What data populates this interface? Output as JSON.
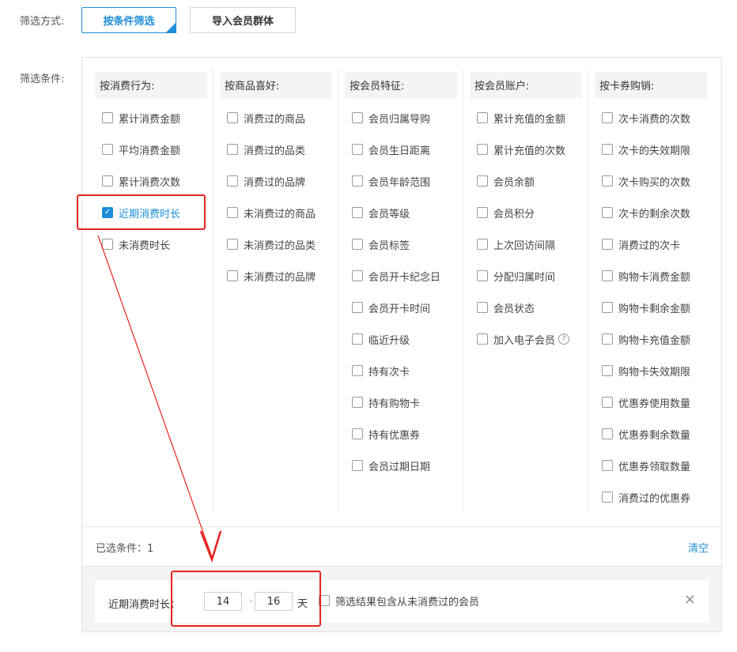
{
  "filter_mode": {
    "label": "筛选方式:",
    "by_condition": "按条件筛选",
    "import_group": "导入会员群体"
  },
  "filter_conditions": {
    "label": "筛选条件:",
    "columns": [
      {
        "header": "按消费行为:",
        "options": [
          {
            "label": "累计消费金额",
            "checked": false
          },
          {
            "label": "平均消费金额",
            "checked": false
          },
          {
            "label": "累计消费次数",
            "checked": false
          },
          {
            "label": "近期消费时长",
            "checked": true
          },
          {
            "label": "未消费时长",
            "checked": false
          }
        ]
      },
      {
        "header": "按商品喜好:",
        "options": [
          {
            "label": "消费过的商品",
            "checked": false
          },
          {
            "label": "消费过的品类",
            "checked": false
          },
          {
            "label": "消费过的品牌",
            "checked": false
          },
          {
            "label": "未消费过的商品",
            "checked": false
          },
          {
            "label": "未消费过的品类",
            "checked": false
          },
          {
            "label": "未消费过的品牌",
            "checked": false
          }
        ]
      },
      {
        "header": "按会员特征:",
        "options": [
          {
            "label": "会员归属导购",
            "checked": false
          },
          {
            "label": "会员生日距离",
            "checked": false
          },
          {
            "label": "会员年龄范围",
            "checked": false
          },
          {
            "label": "会员等级",
            "checked": false
          },
          {
            "label": "会员标签",
            "checked": false
          },
          {
            "label": "会员开卡纪念日",
            "checked": false
          },
          {
            "label": "会员开卡时间",
            "checked": false
          },
          {
            "label": "临近升级",
            "checked": false
          },
          {
            "label": "持有次卡",
            "checked": false
          },
          {
            "label": "持有购物卡",
            "checked": false
          },
          {
            "label": "持有优惠券",
            "checked": false
          },
          {
            "label": "会员过期日期",
            "checked": false
          }
        ]
      },
      {
        "header": "按会员账户:",
        "options": [
          {
            "label": "累计充值的金额",
            "checked": false
          },
          {
            "label": "累计充值的次数",
            "checked": false
          },
          {
            "label": "会员余额",
            "checked": false
          },
          {
            "label": "会员积分",
            "checked": false
          },
          {
            "label": "上次回访间隔",
            "checked": false
          },
          {
            "label": "分配归属时间",
            "checked": false
          },
          {
            "label": "会员状态",
            "checked": false
          },
          {
            "label": "加入电子会员",
            "checked": false,
            "help": "?"
          }
        ]
      },
      {
        "header": "按卡券购销:",
        "options": [
          {
            "label": "次卡消费的次数",
            "checked": false
          },
          {
            "label": "次卡的失效期限",
            "checked": false
          },
          {
            "label": "次卡购买的次数",
            "checked": false
          },
          {
            "label": "次卡的剩余次数",
            "checked": false
          },
          {
            "label": "消费过的次卡",
            "checked": false
          },
          {
            "label": "购物卡消费金额",
            "checked": false
          },
          {
            "label": "购物卡剩余金额",
            "checked": false
          },
          {
            "label": "购物卡充值金额",
            "checked": false
          },
          {
            "label": "购物卡失效期限",
            "checked": false
          },
          {
            "label": "优惠券使用数量",
            "checked": false
          },
          {
            "label": "优惠券剩余数量",
            "checked": false
          },
          {
            "label": "优惠券领取数量",
            "checked": false
          },
          {
            "label": "消费过的优惠券",
            "checked": false
          }
        ]
      }
    ]
  },
  "selected": {
    "text": "已选条件：1",
    "clear": "清空"
  },
  "condition_row": {
    "label": "近期消费时长：",
    "min_value": "14",
    "separator": "-",
    "max_value": "16",
    "unit": "天",
    "include_label": "筛选结果包含从未消费过的会员",
    "include_checked": false,
    "close_icon": "×"
  },
  "icons": {
    "check": "✓",
    "corner_check": "✓"
  },
  "colors": {
    "accent": "#1f8ed8",
    "annotation_red": "#e8231f"
  }
}
